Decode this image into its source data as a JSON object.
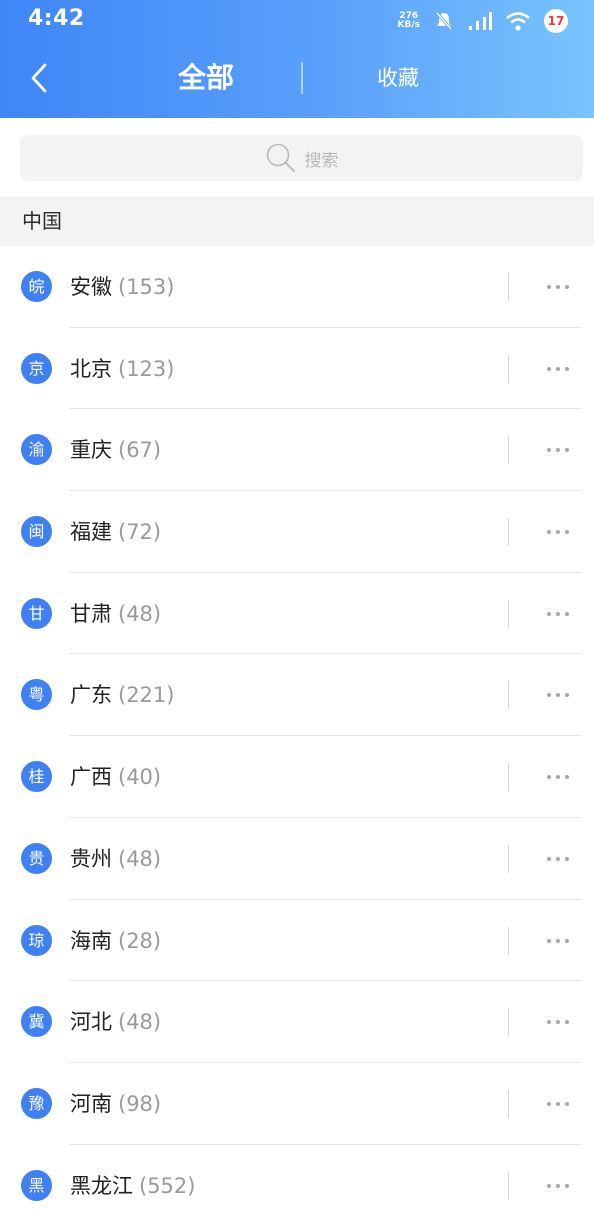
{
  "status_bar": {
    "time": "4:42",
    "net_speed_value": "276",
    "net_speed_unit": "KB/s",
    "battery_level": "17",
    "icons": [
      "bell-off-icon",
      "signal-icon",
      "wifi-icon",
      "battery-icon"
    ]
  },
  "header": {
    "tab_all": "全部",
    "tab_favorites": "收藏",
    "back_icon": "chevron-left-icon",
    "colors": {
      "gradient_start": "#3f86f7",
      "gradient_end": "#78c4fd"
    }
  },
  "search": {
    "placeholder": "搜索",
    "icon": "search-icon"
  },
  "section": {
    "title": "中国"
  },
  "accent_color": "#3f80f3",
  "provinces": [
    {
      "abbr": "皖",
      "name": "安徽",
      "count": "(153)"
    },
    {
      "abbr": "京",
      "name": "北京",
      "count": "(123)"
    },
    {
      "abbr": "渝",
      "name": "重庆",
      "count": "(67)"
    },
    {
      "abbr": "闽",
      "name": "福建",
      "count": "(72)"
    },
    {
      "abbr": "甘",
      "name": "甘肃",
      "count": "(48)"
    },
    {
      "abbr": "粤",
      "name": "广东",
      "count": "(221)"
    },
    {
      "abbr": "桂",
      "name": "广西",
      "count": "(40)"
    },
    {
      "abbr": "贵",
      "name": "贵州",
      "count": "(48)"
    },
    {
      "abbr": "琼",
      "name": "海南",
      "count": "(28)"
    },
    {
      "abbr": "冀",
      "name": "河北",
      "count": "(48)"
    },
    {
      "abbr": "豫",
      "name": "河南",
      "count": "(98)"
    },
    {
      "abbr": "黑",
      "name": "黑龙江",
      "count": "(552)"
    }
  ]
}
